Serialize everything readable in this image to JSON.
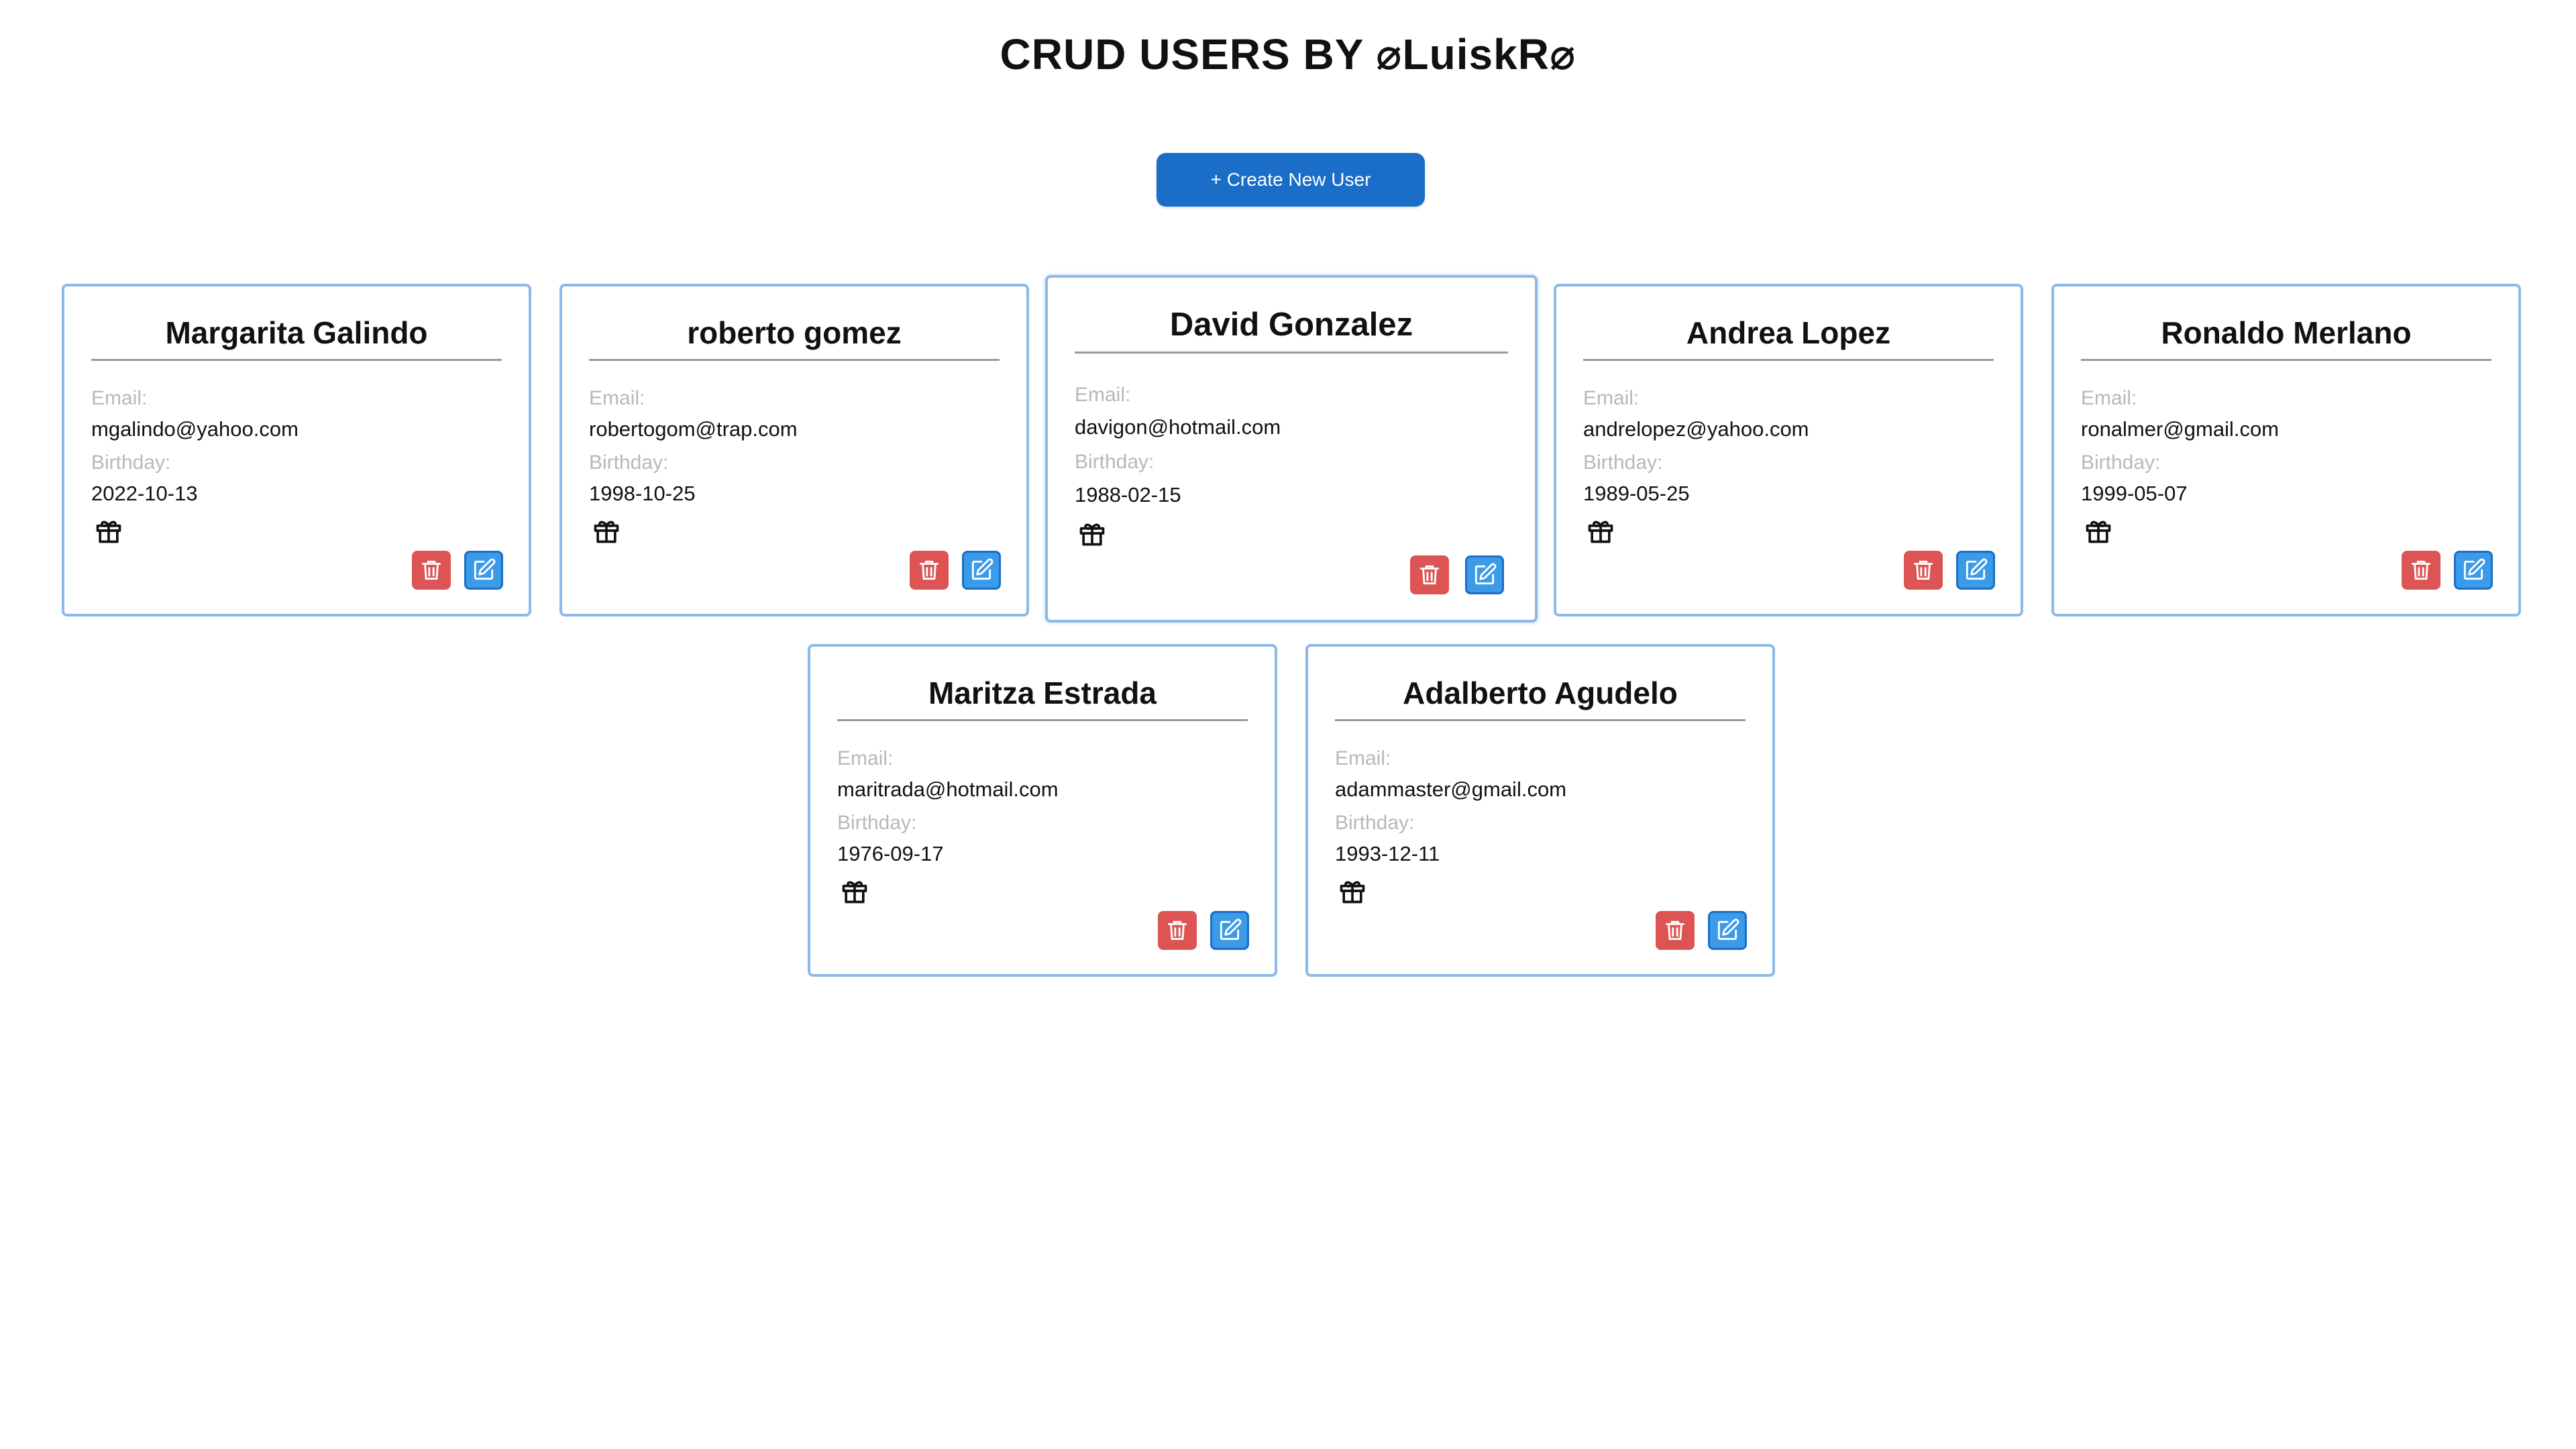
{
  "header": {
    "title": "CRUD USERS BY ⌀LuiskR⌀"
  },
  "toolbar": {
    "create_label": "+ Create New User"
  },
  "labels": {
    "email": "Email:",
    "birthday": "Birthday:"
  },
  "colors": {
    "accent": "#1a6ec8",
    "card_border": "#8cb9e8",
    "delete": "#dc5454",
    "edit": "#3b9be8"
  },
  "icons": {
    "delete": "trash-icon",
    "edit": "edit-icon",
    "birthday": "gift-icon"
  },
  "users": [
    {
      "name": "Margarita Galindo",
      "email": "mgalindo@yahoo.com",
      "birthday": "2022-10-13"
    },
    {
      "name": "roberto gomez",
      "email": "robertogom@trap.com",
      "birthday": "1998-10-25"
    },
    {
      "name": "David Gonzalez",
      "email": "davigon@hotmail.com",
      "birthday": "1988-02-15"
    },
    {
      "name": "Andrea Lopez",
      "email": "andrelopez@yahoo.com",
      "birthday": "1989-05-25"
    },
    {
      "name": "Ronaldo Merlano",
      "email": "ronalmer@gmail.com",
      "birthday": "1999-05-07"
    },
    {
      "name": "Maritza Estrada",
      "email": "maritrada@hotmail.com",
      "birthday": "1976-09-17"
    },
    {
      "name": "Adalberto Agudelo",
      "email": "adammaster@gmail.com",
      "birthday": "1993-12-11"
    }
  ]
}
